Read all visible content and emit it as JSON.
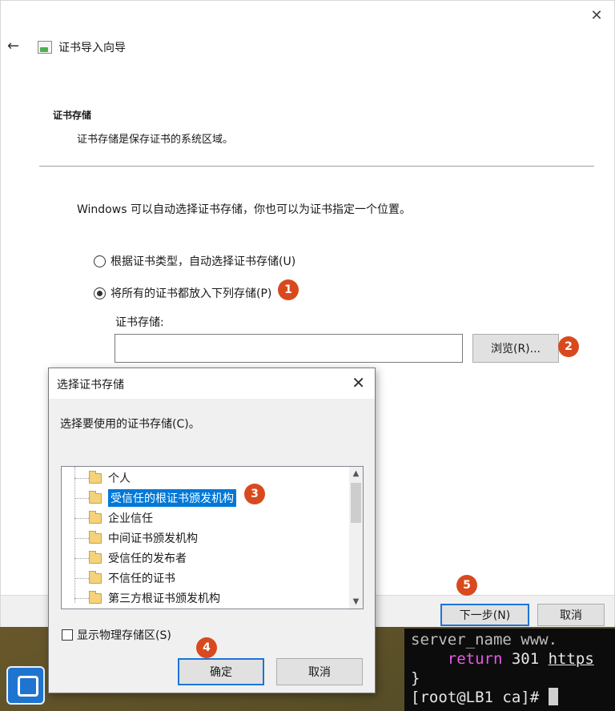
{
  "wizard": {
    "title": "证书导入向导",
    "section_title": "证书存储",
    "section_desc": "证书存储是保存证书的系统区域。",
    "info": "Windows 可以自动选择证书存储，你也可以为证书指定一个位置。",
    "radio_auto_label": "根据证书类型，自动选择证书存储(U)",
    "radio_manual_label": "将所有的证书都放入下列存储(P)",
    "store_label": "证书存储:",
    "store_value": "",
    "browse_label": "浏览(R)...",
    "next_label": "下一步(N)",
    "cancel_label": "取消"
  },
  "dialog": {
    "title": "选择证书存储",
    "prompt": "选择要使用的证书存储(C)。",
    "stores": [
      "个人",
      "受信任的根证书颁发机构",
      "企业信任",
      "中间证书颁发机构",
      "受信任的发布者",
      "不信任的证书",
      "第三方根证书颁发机构"
    ],
    "selected_index": 1,
    "show_physical_label": "显示物理存储区(S)",
    "ok_label": "确定",
    "cancel_label": "取消"
  },
  "badges": [
    "1",
    "2",
    "3",
    "4",
    "5"
  ],
  "terminal": {
    "line1": "server_name www.",
    "line2_kw": "return",
    "line2_rest": " 301 ",
    "line2_url": "https",
    "line3": "}",
    "prompt": "[root@LB1 ca]# "
  },
  "colors": {
    "accent": "#0078d7",
    "badge": "#d84a1e",
    "terminal_keyword": "#e85ae8"
  }
}
